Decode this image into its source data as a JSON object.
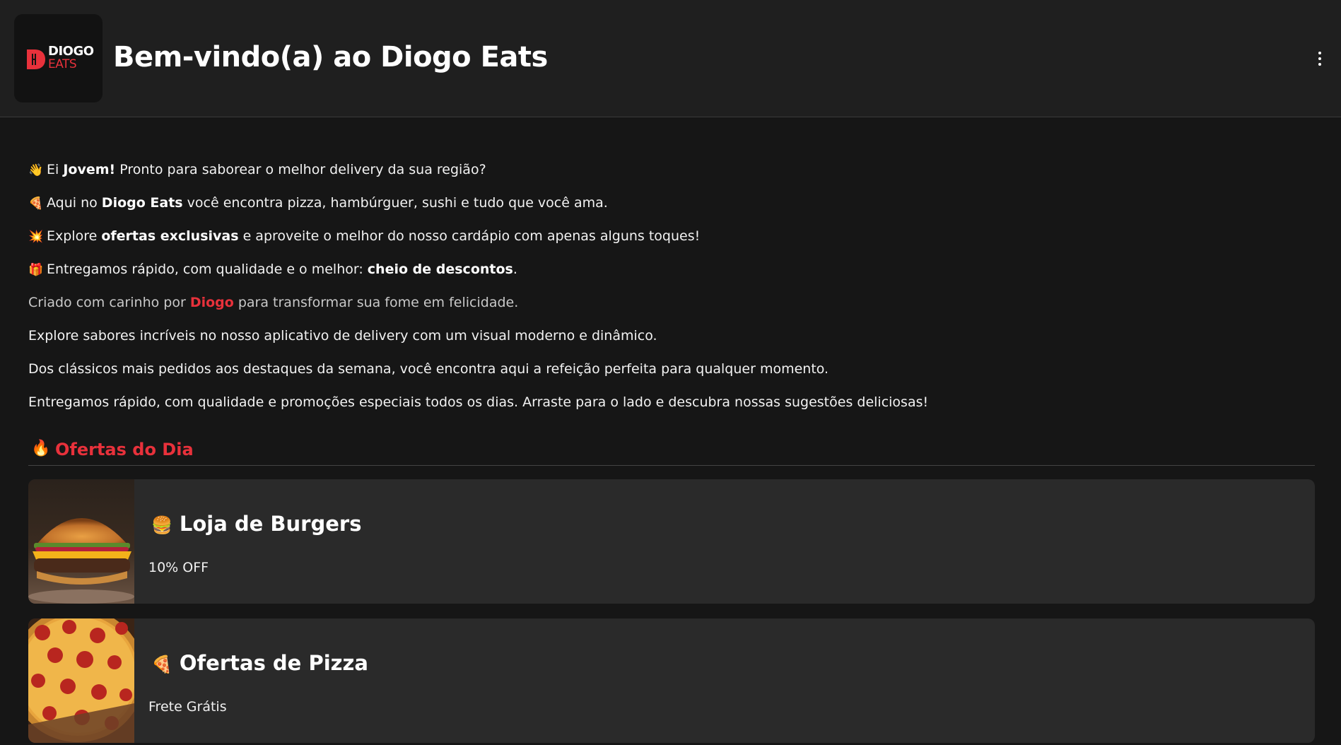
{
  "header": {
    "logo_line1": "DIOGO",
    "logo_line2": "EATS",
    "title": "Bem-vindo(a) ao Diogo Eats",
    "menu_icon": "more-vertical-icon"
  },
  "intro": [
    {
      "emoji": "👋",
      "pre": "Ei ",
      "bold": "Jovem!",
      "post": " Pronto para saborear o melhor delivery da sua região?"
    },
    {
      "emoji": "🍕",
      "pre": "Aqui no ",
      "bold": "Diogo Eats",
      "post": " você encontra pizza, hambúrguer, sushi e tudo que você ama."
    },
    {
      "emoji": "💥",
      "pre": "Explore ",
      "bold": "ofertas exclusivas",
      "post": " e aproveite o melhor do nosso cardápio com apenas alguns toques!"
    },
    {
      "emoji": "🎁",
      "pre": "Entregamos rápido, com qualidade e o melhor: ",
      "bold": "cheio de descontos",
      "post": "."
    }
  ],
  "credit": {
    "pre": "Criado com carinho por ",
    "name": "Diogo",
    "post": " para transformar sua fome em felicidade."
  },
  "paragraphs": [
    "Explore sabores incríveis no nosso aplicativo de delivery com um visual moderno e dinâmico.",
    "Dos clássicos mais pedidos aos destaques da semana, você encontra aqui a refeição perfeita para qualquer momento.",
    "Entregamos rápido, com qualidade e promoções especiais todos os dias. Arraste para o lado e descubra nossas sugestões deliciosas!"
  ],
  "offers_section": {
    "emoji": "🔥",
    "title": "Ofertas do Dia"
  },
  "offers": [
    {
      "emoji": "🍔",
      "title": "Loja de Burgers",
      "subtitle": "10% OFF",
      "image_icon": "burger-photo"
    },
    {
      "emoji": "🍕",
      "title": "Ofertas de Pizza",
      "subtitle": "Frete Grátis",
      "image_icon": "pizza-photo"
    }
  ],
  "colors": {
    "accent": "#e8313b",
    "background": "#161616",
    "header": "#1f1f1f",
    "card": "#2a2a2a"
  }
}
